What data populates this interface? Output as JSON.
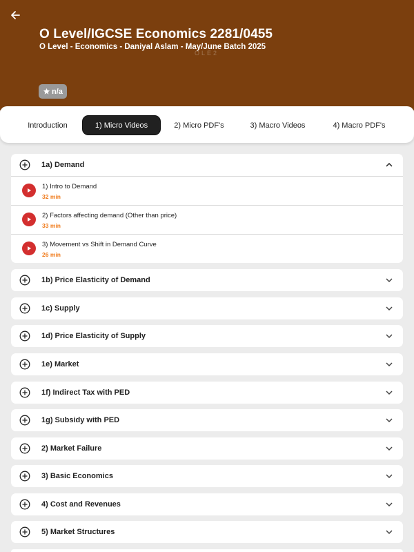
{
  "course": {
    "title": "O Level/IGCSE Economics 2281/0455",
    "subtitle": "O Level - Economics - Daniyal Aslam - May/June Batch 2025",
    "watermark": "OLE2",
    "rating": "n/a"
  },
  "tabs": [
    {
      "label": "Introduction",
      "active": false
    },
    {
      "label": "1) Micro Videos",
      "active": true
    },
    {
      "label": "2) Micro PDF's",
      "active": false
    },
    {
      "label": "3) Macro Videos",
      "active": false
    },
    {
      "label": "4) Macro PDF's",
      "active": false
    }
  ],
  "sections": [
    {
      "title": "1a) Demand",
      "expanded": true,
      "lessons": [
        {
          "title": "1) Intro to Demand",
          "duration": "32 min"
        },
        {
          "title": "2) Factors affecting demand (Other than price)",
          "duration": "33 min"
        },
        {
          "title": "3) Movement vs Shift in Demand Curve",
          "duration": "26 min"
        }
      ]
    },
    {
      "title": "1b) Price Elasticity of Demand",
      "expanded": false
    },
    {
      "title": "1c) Supply",
      "expanded": false
    },
    {
      "title": "1d) Price Elasticity of Supply",
      "expanded": false
    },
    {
      "title": "1e) Market",
      "expanded": false
    },
    {
      "title": "1f) Indirect Tax with PED",
      "expanded": false
    },
    {
      "title": "1g) Subsidy with PED",
      "expanded": false
    },
    {
      "title": "2) Market Failure",
      "expanded": false
    },
    {
      "title": "3) Basic Economics",
      "expanded": false
    },
    {
      "title": "4) Cost and Revenues",
      "expanded": false
    },
    {
      "title": "5) Market Structures",
      "expanded": false
    }
  ],
  "colors": {
    "header_bg": "#7b3f0e",
    "active_tab_bg": "#212121",
    "play_button": "#d32f2f",
    "duration_text": "#f07a1a"
  },
  "icons": {
    "back": "arrow-left-icon",
    "rating": "star-icon",
    "section": "plus-circle-icon",
    "expand": "chevron-down-icon",
    "collapse": "chevron-up-icon",
    "play": "play-icon"
  }
}
